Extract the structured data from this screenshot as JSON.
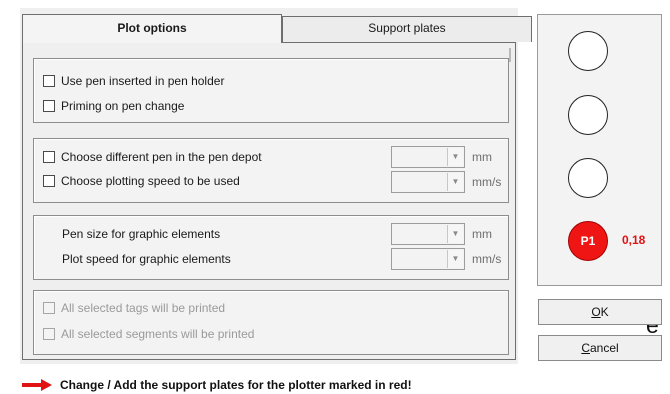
{
  "background_text_fragments": [
    "g",
    ",",
    "e"
  ],
  "tabs": [
    {
      "label": "Plot options",
      "active": true
    },
    {
      "label": "Support plates",
      "active": false
    }
  ],
  "group1": {
    "items": [
      {
        "label": "Use pen inserted in pen holder",
        "checked": false
      },
      {
        "label": "Priming on pen change",
        "checked": false
      }
    ]
  },
  "group2": {
    "items": [
      {
        "label": "Choose different pen in the pen depot",
        "checked": false,
        "unit": "mm",
        "value": ""
      },
      {
        "label": "Choose plotting speed to be used",
        "checked": false,
        "unit": "mm/s",
        "value": ""
      }
    ]
  },
  "group3": {
    "items": [
      {
        "label": "Pen size for graphic elements",
        "unit": "mm",
        "value": ""
      },
      {
        "label": "Plot speed for graphic elements",
        "unit": "mm/s",
        "value": ""
      }
    ]
  },
  "group4": {
    "items": [
      {
        "label": "All selected tags will be printed",
        "checked": false,
        "disabled": true
      },
      {
        "label": "All selected segments will be printed",
        "checked": false,
        "disabled": true
      }
    ]
  },
  "pen_slots": [
    {
      "label": "",
      "active": false
    },
    {
      "label": "",
      "active": false
    },
    {
      "label": "",
      "active": false
    },
    {
      "label": "P1",
      "active": true,
      "size": "0,18",
      "color": "#ef1515"
    }
  ],
  "buttons": {
    "ok_key": "O",
    "ok_rest": "K",
    "cancel_key": "C",
    "cancel_rest": "ancel"
  },
  "footer": {
    "message": "Change / Add the support plates for the plotter marked in red!",
    "arrow_color": "#e01212"
  }
}
